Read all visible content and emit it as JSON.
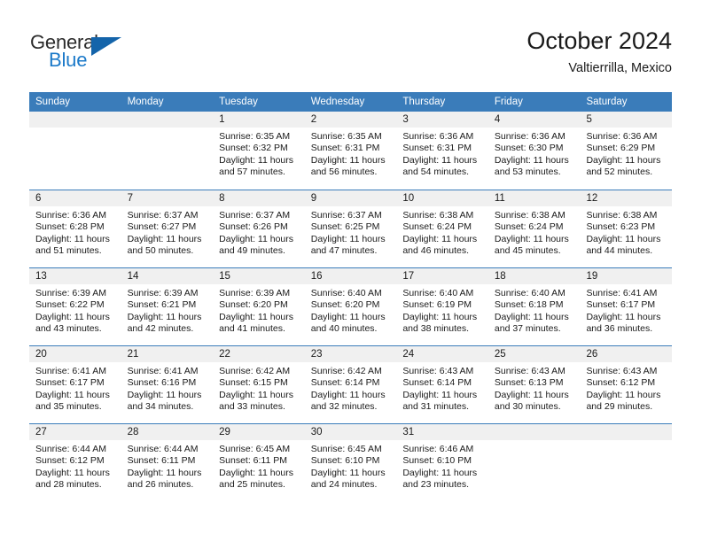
{
  "logo": {
    "word_top": "General",
    "word_bottom": "Blue",
    "triangle_color": "#1464aa",
    "blue_color": "#1c7ac9"
  },
  "header": {
    "title": "October 2024",
    "location": "Valtierrilla, Mexico"
  },
  "theme": {
    "header_blue": "#3a7cba",
    "day_band_gray": "#f0f0f0",
    "text": "#1a1a1a"
  },
  "weekday_headers": [
    "Sunday",
    "Monday",
    "Tuesday",
    "Wednesday",
    "Thursday",
    "Friday",
    "Saturday"
  ],
  "weeks": [
    [
      {
        "day": "",
        "sunrise": "",
        "sunset": "",
        "daylight_line1": "",
        "daylight_line2": ""
      },
      {
        "day": "",
        "sunrise": "",
        "sunset": "",
        "daylight_line1": "",
        "daylight_line2": ""
      },
      {
        "day": "1",
        "sunrise": "Sunrise: 6:35 AM",
        "sunset": "Sunset: 6:32 PM",
        "daylight_line1": "Daylight: 11 hours",
        "daylight_line2": "and 57 minutes."
      },
      {
        "day": "2",
        "sunrise": "Sunrise: 6:35 AM",
        "sunset": "Sunset: 6:31 PM",
        "daylight_line1": "Daylight: 11 hours",
        "daylight_line2": "and 56 minutes."
      },
      {
        "day": "3",
        "sunrise": "Sunrise: 6:36 AM",
        "sunset": "Sunset: 6:31 PM",
        "daylight_line1": "Daylight: 11 hours",
        "daylight_line2": "and 54 minutes."
      },
      {
        "day": "4",
        "sunrise": "Sunrise: 6:36 AM",
        "sunset": "Sunset: 6:30 PM",
        "daylight_line1": "Daylight: 11 hours",
        "daylight_line2": "and 53 minutes."
      },
      {
        "day": "5",
        "sunrise": "Sunrise: 6:36 AM",
        "sunset": "Sunset: 6:29 PM",
        "daylight_line1": "Daylight: 11 hours",
        "daylight_line2": "and 52 minutes."
      }
    ],
    [
      {
        "day": "6",
        "sunrise": "Sunrise: 6:36 AM",
        "sunset": "Sunset: 6:28 PM",
        "daylight_line1": "Daylight: 11 hours",
        "daylight_line2": "and 51 minutes."
      },
      {
        "day": "7",
        "sunrise": "Sunrise: 6:37 AM",
        "sunset": "Sunset: 6:27 PM",
        "daylight_line1": "Daylight: 11 hours",
        "daylight_line2": "and 50 minutes."
      },
      {
        "day": "8",
        "sunrise": "Sunrise: 6:37 AM",
        "sunset": "Sunset: 6:26 PM",
        "daylight_line1": "Daylight: 11 hours",
        "daylight_line2": "and 49 minutes."
      },
      {
        "day": "9",
        "sunrise": "Sunrise: 6:37 AM",
        "sunset": "Sunset: 6:25 PM",
        "daylight_line1": "Daylight: 11 hours",
        "daylight_line2": "and 47 minutes."
      },
      {
        "day": "10",
        "sunrise": "Sunrise: 6:38 AM",
        "sunset": "Sunset: 6:24 PM",
        "daylight_line1": "Daylight: 11 hours",
        "daylight_line2": "and 46 minutes."
      },
      {
        "day": "11",
        "sunrise": "Sunrise: 6:38 AM",
        "sunset": "Sunset: 6:24 PM",
        "daylight_line1": "Daylight: 11 hours",
        "daylight_line2": "and 45 minutes."
      },
      {
        "day": "12",
        "sunrise": "Sunrise: 6:38 AM",
        "sunset": "Sunset: 6:23 PM",
        "daylight_line1": "Daylight: 11 hours",
        "daylight_line2": "and 44 minutes."
      }
    ],
    [
      {
        "day": "13",
        "sunrise": "Sunrise: 6:39 AM",
        "sunset": "Sunset: 6:22 PM",
        "daylight_line1": "Daylight: 11 hours",
        "daylight_line2": "and 43 minutes."
      },
      {
        "day": "14",
        "sunrise": "Sunrise: 6:39 AM",
        "sunset": "Sunset: 6:21 PM",
        "daylight_line1": "Daylight: 11 hours",
        "daylight_line2": "and 42 minutes."
      },
      {
        "day": "15",
        "sunrise": "Sunrise: 6:39 AM",
        "sunset": "Sunset: 6:20 PM",
        "daylight_line1": "Daylight: 11 hours",
        "daylight_line2": "and 41 minutes."
      },
      {
        "day": "16",
        "sunrise": "Sunrise: 6:40 AM",
        "sunset": "Sunset: 6:20 PM",
        "daylight_line1": "Daylight: 11 hours",
        "daylight_line2": "and 40 minutes."
      },
      {
        "day": "17",
        "sunrise": "Sunrise: 6:40 AM",
        "sunset": "Sunset: 6:19 PM",
        "daylight_line1": "Daylight: 11 hours",
        "daylight_line2": "and 38 minutes."
      },
      {
        "day": "18",
        "sunrise": "Sunrise: 6:40 AM",
        "sunset": "Sunset: 6:18 PM",
        "daylight_line1": "Daylight: 11 hours",
        "daylight_line2": "and 37 minutes."
      },
      {
        "day": "19",
        "sunrise": "Sunrise: 6:41 AM",
        "sunset": "Sunset: 6:17 PM",
        "daylight_line1": "Daylight: 11 hours",
        "daylight_line2": "and 36 minutes."
      }
    ],
    [
      {
        "day": "20",
        "sunrise": "Sunrise: 6:41 AM",
        "sunset": "Sunset: 6:17 PM",
        "daylight_line1": "Daylight: 11 hours",
        "daylight_line2": "and 35 minutes."
      },
      {
        "day": "21",
        "sunrise": "Sunrise: 6:41 AM",
        "sunset": "Sunset: 6:16 PM",
        "daylight_line1": "Daylight: 11 hours",
        "daylight_line2": "and 34 minutes."
      },
      {
        "day": "22",
        "sunrise": "Sunrise: 6:42 AM",
        "sunset": "Sunset: 6:15 PM",
        "daylight_line1": "Daylight: 11 hours",
        "daylight_line2": "and 33 minutes."
      },
      {
        "day": "23",
        "sunrise": "Sunrise: 6:42 AM",
        "sunset": "Sunset: 6:14 PM",
        "daylight_line1": "Daylight: 11 hours",
        "daylight_line2": "and 32 minutes."
      },
      {
        "day": "24",
        "sunrise": "Sunrise: 6:43 AM",
        "sunset": "Sunset: 6:14 PM",
        "daylight_line1": "Daylight: 11 hours",
        "daylight_line2": "and 31 minutes."
      },
      {
        "day": "25",
        "sunrise": "Sunrise: 6:43 AM",
        "sunset": "Sunset: 6:13 PM",
        "daylight_line1": "Daylight: 11 hours",
        "daylight_line2": "and 30 minutes."
      },
      {
        "day": "26",
        "sunrise": "Sunrise: 6:43 AM",
        "sunset": "Sunset: 6:12 PM",
        "daylight_line1": "Daylight: 11 hours",
        "daylight_line2": "and 29 minutes."
      }
    ],
    [
      {
        "day": "27",
        "sunrise": "Sunrise: 6:44 AM",
        "sunset": "Sunset: 6:12 PM",
        "daylight_line1": "Daylight: 11 hours",
        "daylight_line2": "and 28 minutes."
      },
      {
        "day": "28",
        "sunrise": "Sunrise: 6:44 AM",
        "sunset": "Sunset: 6:11 PM",
        "daylight_line1": "Daylight: 11 hours",
        "daylight_line2": "and 26 minutes."
      },
      {
        "day": "29",
        "sunrise": "Sunrise: 6:45 AM",
        "sunset": "Sunset: 6:11 PM",
        "daylight_line1": "Daylight: 11 hours",
        "daylight_line2": "and 25 minutes."
      },
      {
        "day": "30",
        "sunrise": "Sunrise: 6:45 AM",
        "sunset": "Sunset: 6:10 PM",
        "daylight_line1": "Daylight: 11 hours",
        "daylight_line2": "and 24 minutes."
      },
      {
        "day": "31",
        "sunrise": "Sunrise: 6:46 AM",
        "sunset": "Sunset: 6:10 PM",
        "daylight_line1": "Daylight: 11 hours",
        "daylight_line2": "and 23 minutes."
      },
      {
        "day": "",
        "sunrise": "",
        "sunset": "",
        "daylight_line1": "",
        "daylight_line2": ""
      },
      {
        "day": "",
        "sunrise": "",
        "sunset": "",
        "daylight_line1": "",
        "daylight_line2": ""
      }
    ]
  ]
}
